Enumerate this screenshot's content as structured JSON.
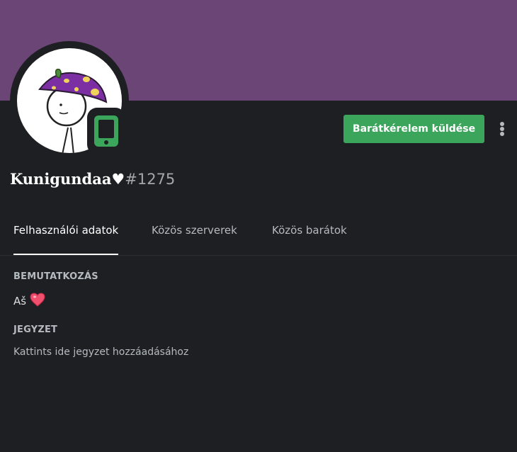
{
  "profile": {
    "display_name": "Kunigundaa♥",
    "discriminator": "#1275",
    "status": "mobile-icon",
    "banner_color": "#6b4575"
  },
  "actions": {
    "friend_request_label": "Barátkérelem küldése",
    "more_icon": "more-vertical-icon"
  },
  "tabs": [
    {
      "label": "Felhasználói adatok",
      "active": true
    },
    {
      "label": "Közös szerverek",
      "active": false
    },
    {
      "label": "Közös barátok",
      "active": false
    }
  ],
  "about": {
    "title": "BEMUTATKOZÁS",
    "text": "Aš",
    "emoji": "heart-icon"
  },
  "note": {
    "title": "JEGYZET",
    "placeholder": "Kattints ide jegyzet hozzáadásához"
  },
  "colors": {
    "accent_green": "#3ba55c",
    "background": "#1e1f22"
  }
}
